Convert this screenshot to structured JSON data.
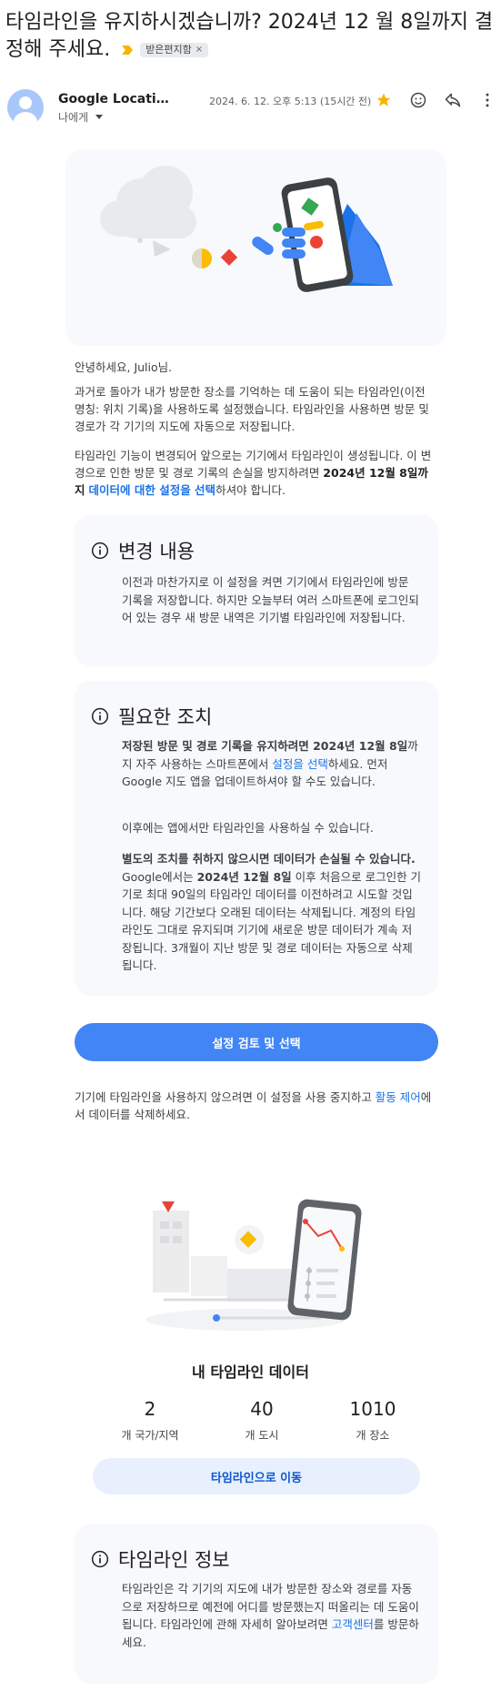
{
  "email": {
    "subject": "타임라인을 유지하시겠습니까? 2024년 12 월 8일까지 결정해 주세요.",
    "label": "받은편지함",
    "label_close": "×",
    "sender": "Google Location History",
    "date": "2024. 6. 12. 오후 5:13 (15시간 전)",
    "to": "나에게",
    "icons": {
      "important": "label-important-icon",
      "star": "star-icon",
      "emoji": "emoji-reaction-icon",
      "reply": "reply-icon",
      "more": "more-vertical-icon"
    },
    "colors": {
      "star": "#f4b400",
      "important": "#f4b400",
      "primary": "#4285f4"
    }
  },
  "body": {
    "greeting": "안녕하세요, Julio님.",
    "p1": "과거로 돌아가 내가 방문한 장소를 기억하는 데 도움이 되는 타임라인(이전 명칭: 위치 기록)을 사용하도록 설정했습니다. 타임라인을 사용하면 방문 및 경로가 각 기기의 지도에 자동으로 저장됩니다.",
    "p2_a": "타임라인 기능이 변경되어 앞으로는 기기에서 타임라인이 생성됩니다. 이 변경으로 인한 방문 및 경로 기록의 손실을 방지하려면 ",
    "p2_bold": "2024년 12월 8일까지",
    "p2_link": "데이터에 대한 설정을 선택",
    "p2_c": "하셔야 합니다."
  },
  "changes": {
    "title": "변경 내용",
    "text": "이전과 마찬가지로 이 설정을 켜면 기기에서 타임라인에 방문 기록을 저장합니다. 하지만 오늘부터 여러 스마트폰에 로그인되어 있는 경우 새 방문 내역은 기기별 타임라인에 저장됩니다."
  },
  "action": {
    "title": "필요한 조치",
    "p1_bold": "저장된 방문 및 경로 기록을 유지하려면 2024년 12월 8일",
    "p1_a": "까지 자주 사용하는 스마트폰에서 ",
    "p1_link": "설정을 선택",
    "p1_b": "하세요. 먼저 Google 지도 앱을 업데이트하셔야 할 수도 있습니다.",
    "p2": "이후에는 앱에서만 타임라인을 사용하실 수 있습니다.",
    "p3_bold": "별도의 조치를 취하지 않으시면 데이터가 손실될 수 있습니다.",
    "p3_a": " Google에서는 ",
    "p3_bold2": "2024년 12월 8일",
    "p3_b": " 이후 처음으로 로그인한 기기로 최대 90일의 타임라인 데이터를 이전하려고 시도할 것입니다. 해당 기간보다 오래된 데이터는 삭제됩니다. 계정의 타임라인도 그대로 유지되며 기기에 새로운 방문 데이터가 계속 저장됩니다. 3개월이 지난 방문 및 경로 데이터는 자동으로 삭제됩니다."
  },
  "review_button": "설정 검토 및 선택",
  "footer_note_a": "기기에 타임라인을 사용하지 않으려면 이 설정을 사용 중지하고 ",
  "footer_note_link": "활동 제어",
  "footer_note_b": "에서 데이터를 삭제하세요.",
  "my_data": {
    "title": "내 타임라인 데이터",
    "stats": [
      {
        "value": "2",
        "label": "개 국가/지역"
      },
      {
        "value": "40",
        "label": "개 도시"
      },
      {
        "value": "1010",
        "label": "개 장소"
      }
    ],
    "button": "타임라인으로 이동"
  },
  "about": {
    "title": "타임라인 정보",
    "text_a": "타임라인은 각 기기의 지도에 내가 방문한 장소와 경로를 자동으로 저장하므로 예전에 어디를 방문했는지 떠올리는 데 도움이 됩니다. 타임라인에 관해 자세히 알아보려면 ",
    "text_link": "고객센터",
    "text_b": "를 방문하세요."
  }
}
